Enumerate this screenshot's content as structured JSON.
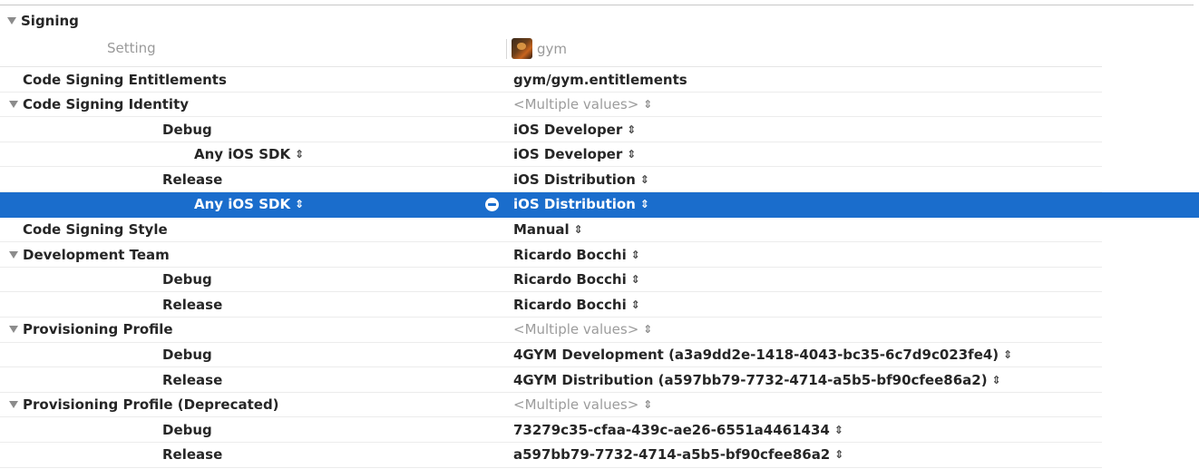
{
  "section": {
    "title": "Signing"
  },
  "header": {
    "setting_label": "Setting",
    "target_name": "gym",
    "target_icon": "app-icon"
  },
  "rows": [
    {
      "label": "Code Signing Entitlements",
      "value": "gym/gym.entitlements",
      "indent": 0,
      "disclosure": false,
      "muted": false,
      "stepper": false,
      "selected": false
    },
    {
      "label": "Code Signing Identity",
      "value": "<Multiple values>",
      "indent": 0,
      "disclosure": true,
      "muted": true,
      "stepper": true,
      "selected": false
    },
    {
      "label": "Debug",
      "value": "iOS Developer",
      "indent": 1,
      "disclosure": false,
      "muted": false,
      "stepper": true,
      "selected": false
    },
    {
      "label": "Any iOS SDK",
      "value": "iOS Developer",
      "indent": 2,
      "disclosure": false,
      "muted": false,
      "stepper": true,
      "label_stepper": true,
      "selected": false
    },
    {
      "label": "Release",
      "value": "iOS Distribution",
      "indent": 1,
      "disclosure": false,
      "muted": false,
      "stepper": true,
      "selected": false
    },
    {
      "label": "Any iOS SDK",
      "value": "iOS Distribution",
      "indent": 2,
      "disclosure": false,
      "muted": false,
      "stepper": true,
      "label_stepper": true,
      "selected": true
    },
    {
      "label": "Code Signing Style",
      "value": "Manual",
      "indent": 0,
      "disclosure": false,
      "muted": false,
      "stepper": true,
      "selected": false
    },
    {
      "label": "Development Team",
      "value": "Ricardo Bocchi",
      "indent": 0,
      "disclosure": true,
      "muted": false,
      "stepper": true,
      "selected": false
    },
    {
      "label": "Debug",
      "value": "Ricardo Bocchi",
      "indent": 1,
      "disclosure": false,
      "muted": false,
      "stepper": true,
      "selected": false
    },
    {
      "label": "Release",
      "value": "Ricardo Bocchi",
      "indent": 1,
      "disclosure": false,
      "muted": false,
      "stepper": true,
      "selected": false
    },
    {
      "label": "Provisioning Profile",
      "value": "<Multiple values>",
      "indent": 0,
      "disclosure": true,
      "muted": true,
      "stepper": true,
      "selected": false
    },
    {
      "label": "Debug",
      "value": "4GYM Development (a3a9dd2e-1418-4043-bc35-6c7d9c023fe4)",
      "indent": 1,
      "disclosure": false,
      "muted": false,
      "stepper": true,
      "selected": false
    },
    {
      "label": "Release",
      "value": "4GYM Distribution (a597bb79-7732-4714-a5b5-bf90cfee86a2)",
      "indent": 1,
      "disclosure": false,
      "muted": false,
      "stepper": true,
      "selected": false
    },
    {
      "label": "Provisioning Profile (Deprecated)",
      "value": "<Multiple values>",
      "indent": 0,
      "disclosure": true,
      "muted": true,
      "stepper": true,
      "selected": false
    },
    {
      "label": "Debug",
      "value": "73279c35-cfaa-439c-ae26-6551a4461434",
      "indent": 1,
      "disclosure": false,
      "muted": false,
      "stepper": true,
      "selected": false
    },
    {
      "label": "Release",
      "value": "a597bb79-7732-4714-a5b5-bf90cfee86a2",
      "indent": 1,
      "disclosure": false,
      "muted": false,
      "stepper": true,
      "selected": false
    }
  ],
  "colors": {
    "selection": "#1a6dcc",
    "text": "#262626",
    "muted_text": "#9c9c9c"
  }
}
